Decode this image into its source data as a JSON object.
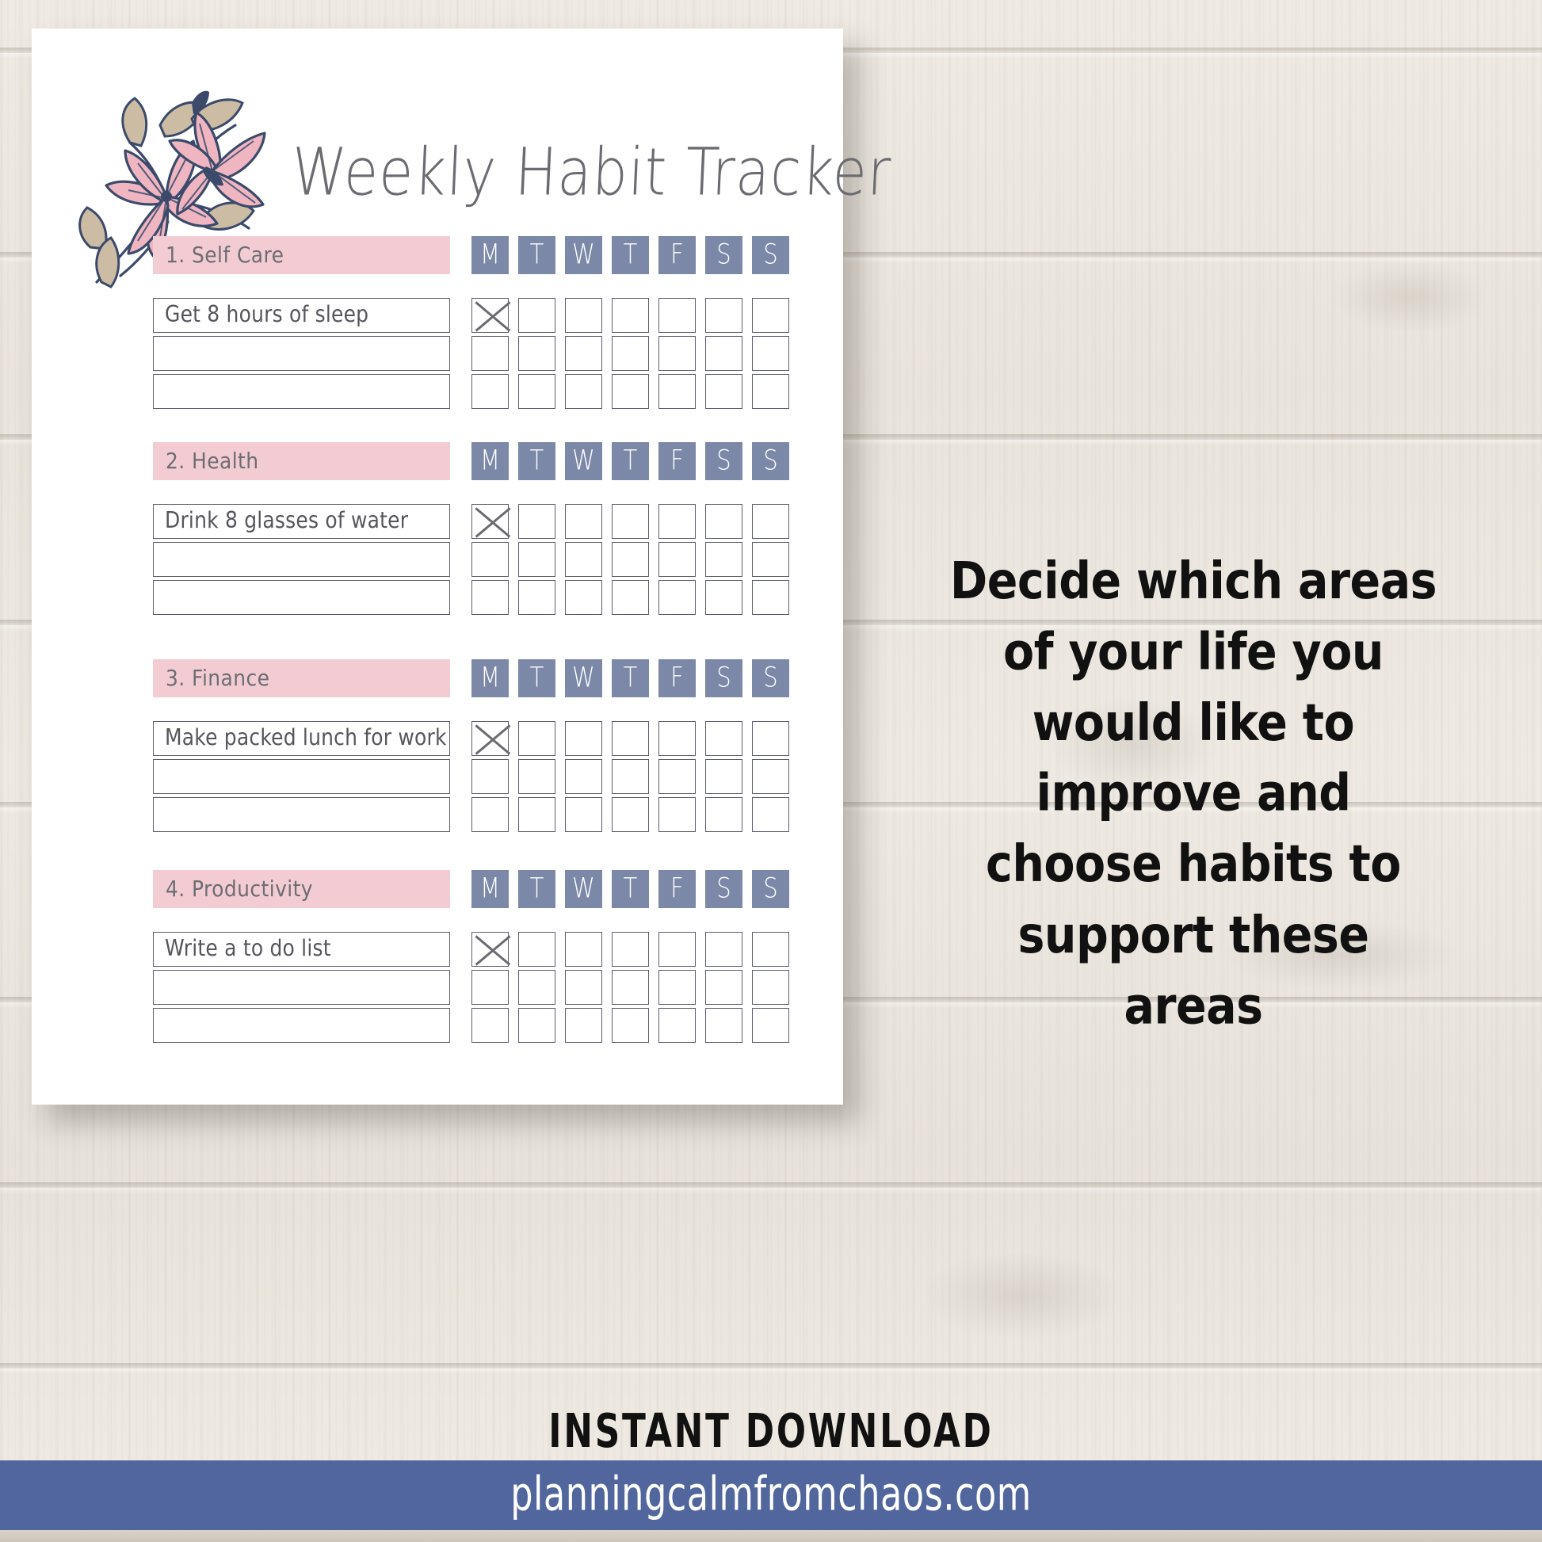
{
  "document": {
    "title": "Weekly Habit Tracker",
    "days": [
      "M",
      "T",
      "W",
      "T",
      "F",
      "S",
      "S"
    ],
    "sections": [
      {
        "heading": "1. Self Care",
        "rows": [
          {
            "habit": "Get 8 hours of sleep",
            "checks": [
              true,
              false,
              false,
              false,
              false,
              false,
              false
            ]
          },
          {
            "habit": "",
            "checks": [
              false,
              false,
              false,
              false,
              false,
              false,
              false
            ]
          },
          {
            "habit": "",
            "checks": [
              false,
              false,
              false,
              false,
              false,
              false,
              false
            ]
          }
        ]
      },
      {
        "heading": "2. Health",
        "rows": [
          {
            "habit": "Drink 8 glasses of water",
            "checks": [
              true,
              false,
              false,
              false,
              false,
              false,
              false
            ]
          },
          {
            "habit": "",
            "checks": [
              false,
              false,
              false,
              false,
              false,
              false,
              false
            ]
          },
          {
            "habit": "",
            "checks": [
              false,
              false,
              false,
              false,
              false,
              false,
              false
            ]
          }
        ]
      },
      {
        "heading": "3. Finance",
        "rows": [
          {
            "habit": "Make packed lunch for work",
            "checks": [
              true,
              false,
              false,
              false,
              false,
              false,
              false
            ]
          },
          {
            "habit": "",
            "checks": [
              false,
              false,
              false,
              false,
              false,
              false,
              false
            ]
          },
          {
            "habit": "",
            "checks": [
              false,
              false,
              false,
              false,
              false,
              false,
              false
            ]
          }
        ]
      },
      {
        "heading": "4. Productivity",
        "rows": [
          {
            "habit": "Write a to do list",
            "checks": [
              true,
              false,
              false,
              false,
              false,
              false,
              false
            ]
          },
          {
            "habit": "",
            "checks": [
              false,
              false,
              false,
              false,
              false,
              false,
              false
            ]
          },
          {
            "habit": "",
            "checks": [
              false,
              false,
              false,
              false,
              false,
              false,
              false
            ]
          }
        ]
      }
    ]
  },
  "caption": {
    "lines": [
      "Decide which areas",
      "of your life you",
      "would like to",
      "improve and",
      "choose habits to",
      "support these",
      "areas"
    ]
  },
  "promo": {
    "instant_download": "INSTANT DOWNLOAD",
    "website": "planningcalmfromchaos.com"
  },
  "colors": {
    "band_pink": "#f3ccd3",
    "day_blue": "#7b88a8",
    "footer_blue": "#50669c",
    "ink_grey": "#6d6d74",
    "border_grey": "#5c5f6b",
    "flower_pink": "#efb6c2",
    "flower_outline": "#3b4a6b",
    "leaf_tan": "#cdbca4"
  }
}
